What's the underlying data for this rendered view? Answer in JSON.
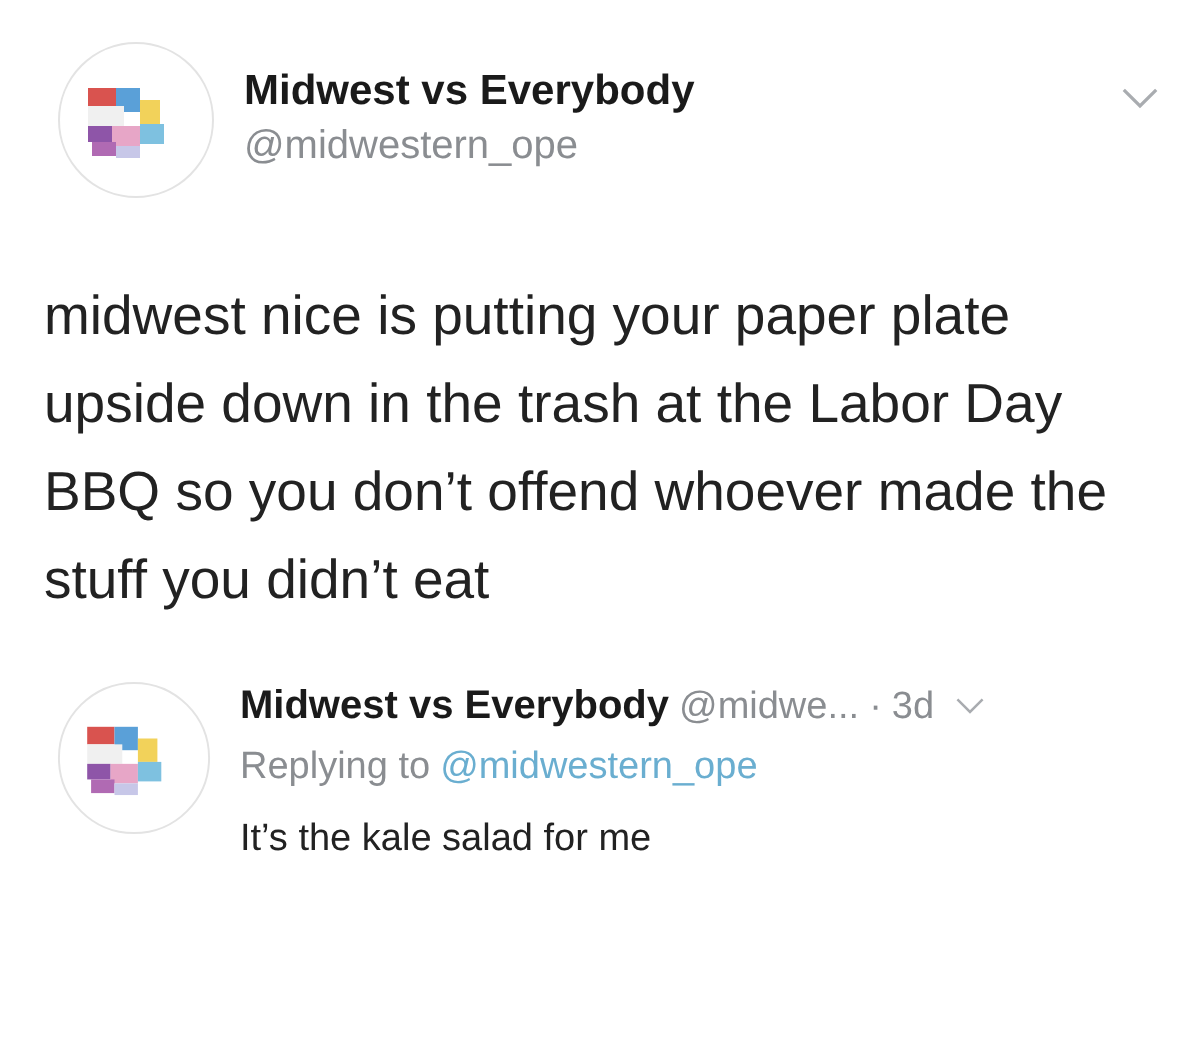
{
  "tweet": {
    "name": "Midwest vs Everybody",
    "handle": "@midwestern_ope",
    "text": "midwest nice is putting your paper plate upside down in the trash at the Labor Day BBQ so you don’t offend whoever made the stuff you didn’t eat"
  },
  "reply": {
    "name": "Midwest vs Everybody",
    "handle": "@midwe...",
    "separator": "·",
    "time": "3d",
    "replying_label": "Replying to",
    "replying_handle": "@midwestern_ope",
    "text": "It’s the kale salad for me"
  }
}
